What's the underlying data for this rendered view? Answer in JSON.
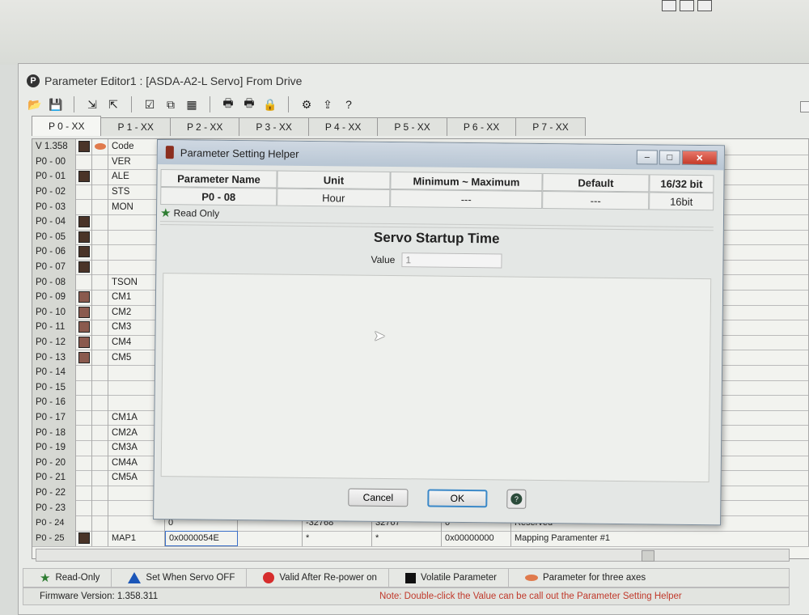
{
  "window_title": "Parameter Editor1 : [ASDA-A2-L Servo]  From Drive",
  "app_logo_letter": "P",
  "tabs": [
    "P 0 - XX",
    "P 1 - XX",
    "P 2 - XX",
    "P 3 - XX",
    "P 4 - XX",
    "P 5 - XX",
    "P 6 - XX",
    "P 7 - XX"
  ],
  "grid": {
    "version": "V 1.358",
    "code_header": "Code",
    "rows": [
      {
        "id": "P0 - 00",
        "code": "VER",
        "sw": "",
        "sw2": ""
      },
      {
        "id": "P0 - 01",
        "code": "ALE",
        "sw": "d",
        "sw2": ""
      },
      {
        "id": "P0 - 02",
        "code": "STS",
        "sw": "",
        "sw2": ""
      },
      {
        "id": "P0 - 03",
        "code": "MON",
        "sw": "",
        "sw2": ""
      },
      {
        "id": "P0 - 04",
        "code": "",
        "sw": "d",
        "sw2": ""
      },
      {
        "id": "P0 - 05",
        "code": "",
        "sw": "d",
        "sw2": ""
      },
      {
        "id": "P0 - 06",
        "code": "",
        "sw": "d",
        "sw2": ""
      },
      {
        "id": "P0 - 07",
        "code": "",
        "sw": "d",
        "sw2": ""
      },
      {
        "id": "P0 - 08",
        "code": "TSON",
        "sw": "",
        "sw2": ""
      },
      {
        "id": "P0 - 09",
        "code": "CM1",
        "sw": "r",
        "sw2": ""
      },
      {
        "id": "P0 - 10",
        "code": "CM2",
        "sw": "r",
        "sw2": ""
      },
      {
        "id": "P0 - 11",
        "code": "CM3",
        "sw": "r",
        "sw2": ""
      },
      {
        "id": "P0 - 12",
        "code": "CM4",
        "sw": "r",
        "sw2": ""
      },
      {
        "id": "P0 - 13",
        "code": "CM5",
        "sw": "r",
        "sw2": ""
      },
      {
        "id": "P0 - 14",
        "code": "",
        "sw": "",
        "sw2": ""
      },
      {
        "id": "P0 - 15",
        "code": "",
        "sw": "",
        "sw2": ""
      },
      {
        "id": "P0 - 16",
        "code": "",
        "sw": "",
        "sw2": ""
      },
      {
        "id": "P0 - 17",
        "code": "CM1A",
        "sw": "",
        "sw2": ""
      },
      {
        "id": "P0 - 18",
        "code": "CM2A",
        "sw": "",
        "sw2": ""
      },
      {
        "id": "P0 - 19",
        "code": "CM3A",
        "sw": "",
        "sw2": ""
      },
      {
        "id": "P0 - 20",
        "code": "CM4A",
        "sw": "",
        "sw2": ""
      },
      {
        "id": "P0 - 21",
        "code": "CM5A",
        "sw": "",
        "sw2": ""
      },
      {
        "id": "P0 - 22",
        "code": "",
        "sw": "",
        "sw2": ""
      },
      {
        "id": "P0 - 23",
        "code": "",
        "sw": "",
        "sw2": ""
      }
    ],
    "row24": {
      "id": "P0 - 24",
      "value": "0",
      "min": "-32768",
      "max": "32767",
      "default": "0",
      "desc": "Reserved"
    },
    "row25": {
      "id": "P0 - 25",
      "code": "MAP1",
      "value": "0x0000054E",
      "min": "*",
      "max": "*",
      "default": "0x00000000",
      "desc": "Mapping Paramenter #1"
    }
  },
  "legend": {
    "read_only": "Read-Only",
    "set_servo_off": "Set When Servo OFF",
    "valid_after": "Valid After Re-power on",
    "volatile": "Volatile Parameter",
    "three_axes": "Parameter for three axes"
  },
  "status": {
    "firmware": "Firmware Version: 1.358.311",
    "note": "Note: Double-click the Value can be call out the Parameter Setting Helper"
  },
  "dialog": {
    "title": "Parameter Setting Helper",
    "headers": {
      "name": "Parameter Name",
      "unit": "Unit",
      "minmax": "Minimum ~ Maximum",
      "default": "Default",
      "bits": "16/32 bit"
    },
    "values": {
      "name": "P0 - 08",
      "unit": "Hour",
      "minmax": "---",
      "default": "---",
      "bits": "16bit"
    },
    "read_only": "Read Only",
    "heading": "Servo Startup Time",
    "value_label": "Value",
    "value": "1",
    "cancel": "Cancel",
    "ok": "OK"
  }
}
